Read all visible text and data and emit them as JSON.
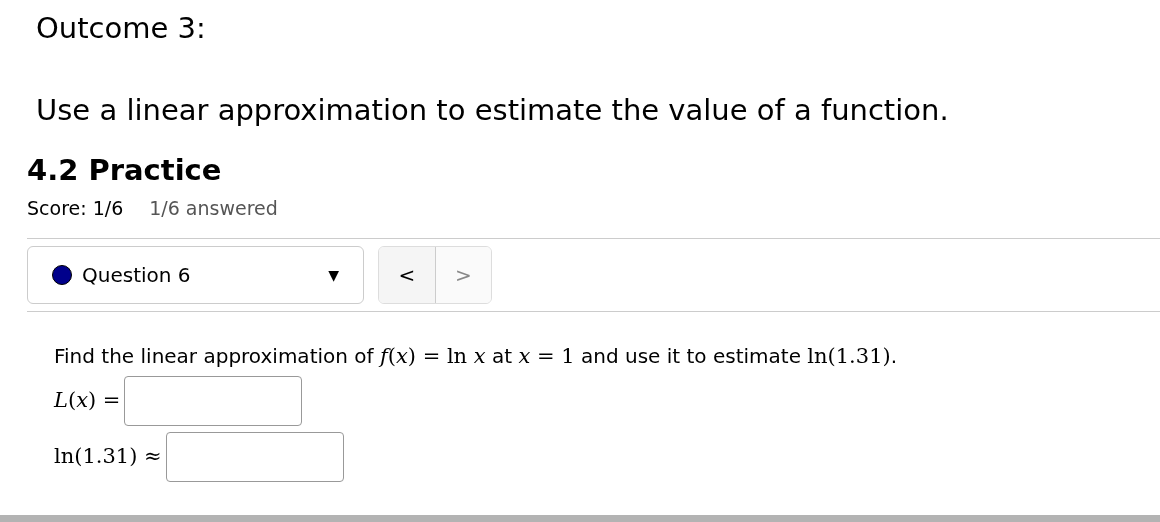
{
  "outcome_title": "Outcome 3:",
  "outcome_description": "Use a linear approximation to estimate the value of a function.",
  "assignment": {
    "title": "4.2 Practice",
    "score": "Score: 1/6",
    "answered": "1/6 answered"
  },
  "question_selector": {
    "label": "Question 6",
    "caret": "▼"
  },
  "nav_buttons": [
    {
      "label": "<",
      "disabled": false
    },
    {
      "label": ">",
      "disabled": true
    }
  ],
  "question": {
    "text": [
      {
        "kind": "text",
        "text": "Find the linear approximation of "
      },
      {
        "kind": "math",
        "text": "*f*(*x*) = ln *x*"
      },
      {
        "kind": "text",
        "text": " at "
      },
      {
        "kind": "math",
        "text": "*x* = 1"
      },
      {
        "kind": "text",
        "text": " and use it to estimate "
      },
      {
        "kind": "math",
        "text": "ln(1.31)"
      },
      {
        "kind": "text",
        "text": "."
      }
    ],
    "answers": [
      {
        "label": "*L*(*x*) ="
      },
      {
        "label": "ln(1.31) ≈"
      }
    ]
  }
}
